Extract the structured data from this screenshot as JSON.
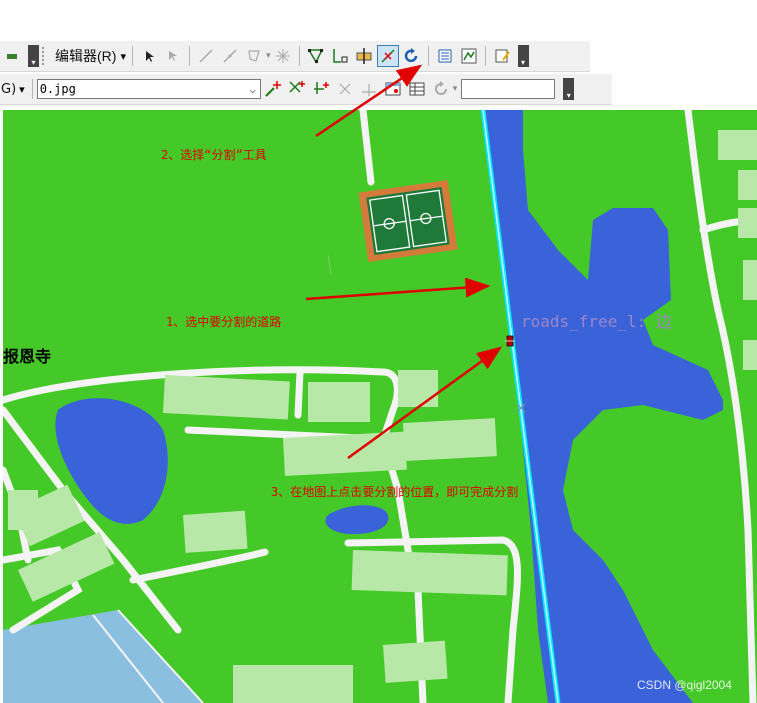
{
  "toolbar1": {
    "editor_menu_label": "编辑器(R)",
    "dropdown_caret": "▾",
    "overflow_glyph": "▾"
  },
  "toolbar2": {
    "field_prefix": "G)",
    "layer_combo_value": "0.jpg",
    "layer_combo_caret": "⌵",
    "search_value": ""
  },
  "map": {
    "place_label": "报恩寺",
    "feature_label": "roads_free_l: 边"
  },
  "annotations": {
    "step1": "1、选中要分割的道路",
    "step2": "2、选择“分割”工具",
    "step3": "3、在地图上点击要分割的位置，即可完成分割"
  },
  "watermark": "CSDN @qigl2004",
  "colors": {
    "grass": "#45c928",
    "water": "#3b63d9",
    "road": "#f4f4f4",
    "building": "#b8e8a8",
    "selection": "#00e5ff",
    "annotation": "#e00000"
  }
}
